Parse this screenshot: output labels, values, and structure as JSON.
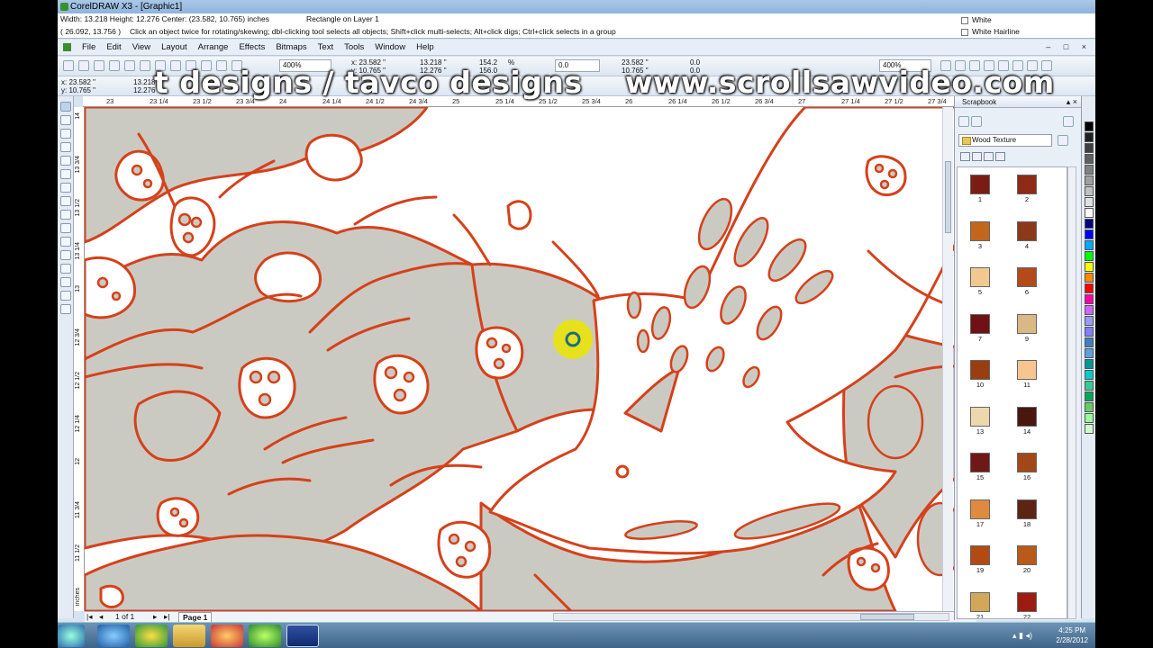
{
  "window": {
    "title": "CorelDRAW X3 - [Graphic1]"
  },
  "infobar": {
    "size_line": "Width: 13.218  Height: 12.276  Center: (23.582, 10.765)  inches",
    "object_line": "Rectangle on Layer 1",
    "cursor": "( 26.092, 13.756 )",
    "hint": "Click an object twice for rotating/skewing; dbl-clicking tool selects all objects; Shift+click multi-selects; Alt+click digs; Ctrl+click selects in a group",
    "fill": "White",
    "outline": "White  Hairline"
  },
  "menu": [
    "File",
    "Edit",
    "View",
    "Layout",
    "Arrange",
    "Effects",
    "Bitmaps",
    "Text",
    "Tools",
    "Window",
    "Help"
  ],
  "toolbar": {
    "zoom_left": "400%",
    "x": "x: 23.582 \"",
    "y": "y: 10.765 \"",
    "w": "13.218 \"",
    "h": "12.276 \"",
    "sx": "154.2",
    "sy": "156.0",
    "pct": "%",
    "angle": "0.0",
    "ref_x": "23.582 \"",
    "ref_y": "10.765 \"",
    "off_x": "0.0",
    "off_y": "0.0",
    "zoom_right": "400%",
    "px": "x: 23.582 \"",
    "py": "y: 10.765 \"",
    "pw": "13.218",
    "ph": "12.276"
  },
  "ruler": {
    "h": [
      "23",
      "23 1/4",
      "23 1/2",
      "23 3/4",
      "24",
      "24 1/4",
      "24 1/2",
      "24 3/4",
      "25",
      "25 1/4",
      "25 1/2",
      "25 3/4",
      "26",
      "26 1/4",
      "26 1/2",
      "26 3/4",
      "27",
      "27 1/4",
      "27 1/2",
      "27 3/4",
      "inches"
    ],
    "v": [
      "14",
      "13 3/4",
      "13 1/2",
      "13 1/4",
      "13",
      "12 3/4",
      "12 1/2",
      "12 1/4",
      "12",
      "11 3/4",
      "11 1/2",
      "inches"
    ]
  },
  "watermark": {
    "left": "t designs / tavco designs",
    "right": "www.scrollsawvideo.com"
  },
  "docker": {
    "title": "Scrapbook",
    "folder": "Wood Texture",
    "swatches": [
      {
        "label": "1",
        "color": "#7b1c14"
      },
      {
        "label": "2",
        "color": "#8e2a16"
      },
      {
        "label": "3",
        "color": "#c2661e"
      },
      {
        "label": "4",
        "color": "#8a3a18"
      },
      {
        "label": "5",
        "color": "#f0c890"
      },
      {
        "label": "6",
        "color": "#b24a1c"
      },
      {
        "label": "7",
        "color": "#6e1216"
      },
      {
        "label": "9",
        "color": "#d9b885"
      },
      {
        "label": "10",
        "color": "#9a3d10"
      },
      {
        "label": "11",
        "color": "#f7c690"
      },
      {
        "label": "13",
        "color": "#ecd8ac"
      },
      {
        "label": "14",
        "color": "#4a1610"
      },
      {
        "label": "15",
        "color": "#6e1818"
      },
      {
        "label": "16",
        "color": "#a24818"
      },
      {
        "label": "17",
        "color": "#e08a40"
      },
      {
        "label": "18",
        "color": "#5c2412"
      },
      {
        "label": "19",
        "color": "#b24a14"
      },
      {
        "label": "20",
        "color": "#b85a1a"
      },
      {
        "label": "21",
        "color": "#d2a858"
      },
      {
        "label": "22",
        "color": "#9c1c12"
      }
    ]
  },
  "palette": [
    "#000000",
    "#202020",
    "#404040",
    "#606060",
    "#808080",
    "#a0a0a0",
    "#c0c0c0",
    "#e0e0e0",
    "#ffffff",
    "#00007f",
    "#0000ff",
    "#00aaff",
    "#00ff00",
    "#ffff00",
    "#ff8800",
    "#ff0000",
    "#ff00aa",
    "#cc66ff",
    "#9999ff",
    "#7f7fff",
    "#3f7fbf",
    "#5fa0df",
    "#009999",
    "#00cccc",
    "#33cc99",
    "#00aa55",
    "#66cc66",
    "#99ff99",
    "#ccffcc"
  ],
  "pagebar": {
    "count": "1 of 1",
    "tab": "Page 1"
  },
  "taskbar": {
    "time": "4:25 PM",
    "date": "2/28/2012"
  }
}
